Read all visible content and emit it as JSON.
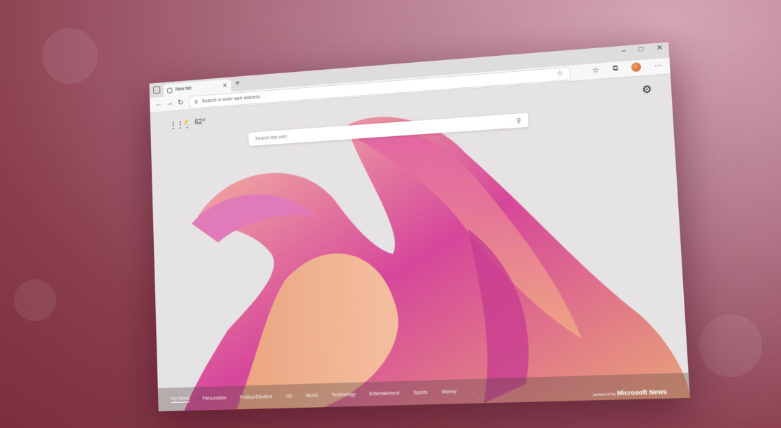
{
  "browser": {
    "tab_title": "New tab",
    "address_placeholder": "Search or enter web address",
    "window_controls": [
      "–",
      "□",
      "✕"
    ]
  },
  "page": {
    "weather_temp": "62°",
    "search_placeholder": "Search the web"
  },
  "news": {
    "items": [
      "My News",
      "Personalize",
      "Politics/Election",
      "US",
      "World",
      "Technology",
      "Entertainment",
      "Sports",
      "Money",
      "..."
    ],
    "powered_prefix": "powered by",
    "powered_brand": "Microsoft News"
  },
  "colors": {
    "background": "#8a3d4e",
    "accent_pink": "#d6479a",
    "accent_peach": "#f0b08e"
  }
}
